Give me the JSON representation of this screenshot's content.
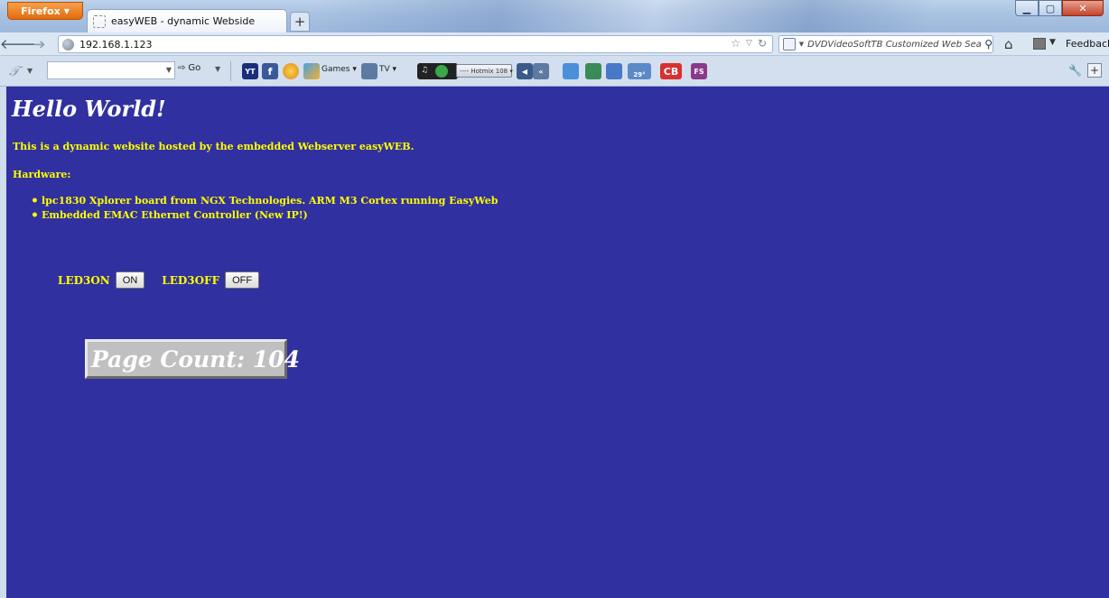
{
  "browser": {
    "menu_button": "Firefox",
    "tab_title": "easyWEB - dynamic Webside",
    "new_tab": "+",
    "url": "192.168.1.123",
    "search_placeholder": "DVDVideoSoftTB Customized Web Searc",
    "feedback": "Feedback",
    "toolbar": {
      "go_label": "Go",
      "games_label": "Games",
      "tv_label": "TV",
      "radio_station": "---- Hotmix 108",
      "weather_temp": "29°",
      "cb_label": "CB",
      "fs_label": "FS",
      "yt_label": "YT",
      "fb_label": "f"
    }
  },
  "page": {
    "heading": "Hello World!",
    "intro": "This is a dynamic website hosted by the embedded Webserver easyWEB.",
    "hardware_label": "Hardware:",
    "hardware_items": [
      "lpc1830 Xplorer board from NGX Technologies. ARM M3 Cortex running EasyWeb",
      "Embedded EMAC Ethernet Controller (New IP!)"
    ],
    "led_on_label": "LED3ON",
    "on_button": "ON",
    "led_off_label": "LED3OFF",
    "off_button": "OFF",
    "page_count": "Page Count: 104"
  },
  "colors": {
    "page_background": "#3030a0",
    "text_yellow": "#ffff00",
    "heading_white": "#ffffff",
    "counter_box": "#c0c0c0"
  }
}
